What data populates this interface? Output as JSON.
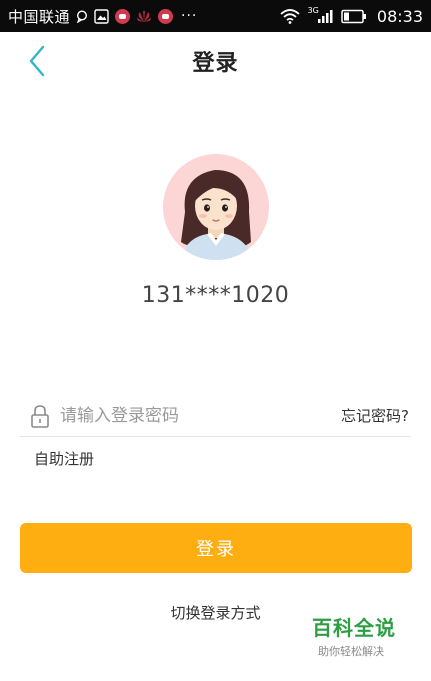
{
  "status_bar": {
    "carrier": "中国联通",
    "time": "08:33",
    "network": "3G",
    "more": "···"
  },
  "header": {
    "title": "登录"
  },
  "account": {
    "number": "131****1020"
  },
  "password": {
    "placeholder": "请输入登录密码",
    "value": ""
  },
  "links": {
    "forgot": "忘记密码?",
    "register": "自助注册",
    "switch": "切换登录方式"
  },
  "login_button": {
    "label": "登录"
  },
  "watermark": {
    "main": "百科全说",
    "sub": "助你轻松解决"
  },
  "colors": {
    "accent_orange": "#ffae11",
    "back_arrow": "#33b5c7",
    "avatar_bg": "#fcd6d4",
    "status_bar": "#0b0b0b",
    "watermark_green": "#2e9e44"
  },
  "icons": [
    "back-arrow-icon",
    "lock-icon",
    "wifi-icon",
    "signal-icon",
    "battery-icon",
    "message-icon",
    "image-icon",
    "app-badge-icon"
  ]
}
